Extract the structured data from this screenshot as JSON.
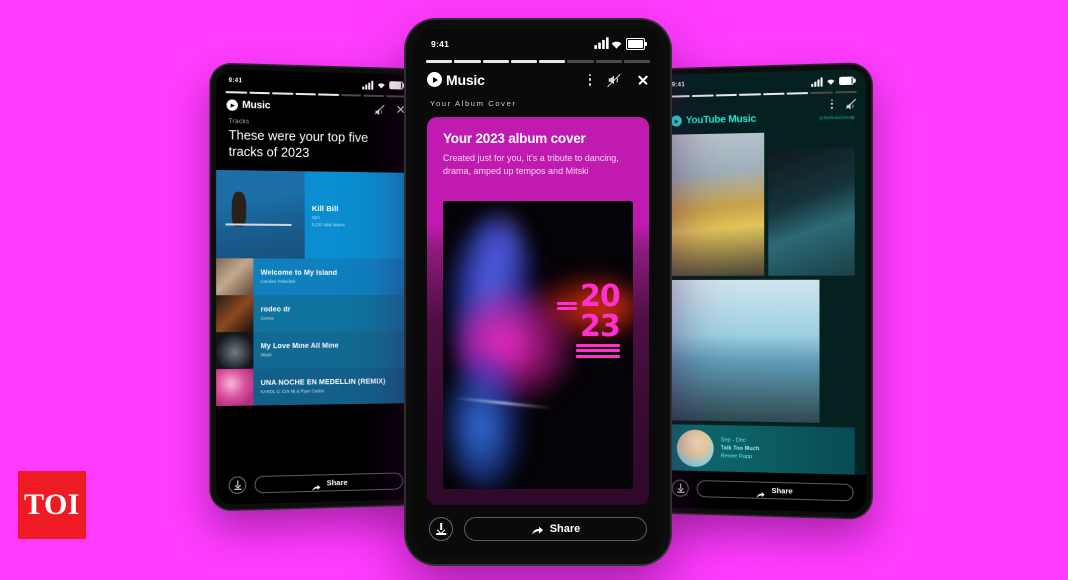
{
  "background_color": "#ff3bff",
  "watermark": {
    "text": "TOI",
    "bg": "#ee1b24"
  },
  "phone_left": {
    "status": {
      "time": "9:41"
    },
    "appbar": {
      "brand": "Music",
      "logo_icon": "youtube-music-logo-icon",
      "menu_icon": "kebab-menu-icon",
      "mute_icon": "mute-icon",
      "close_icon": "close-icon"
    },
    "eyebrow": "Tracks",
    "headline": "These were your top five tracks of 2023",
    "tracks": [
      {
        "title": "Kill Bill",
        "artist": "SZA",
        "plays": "5,233 total listens"
      },
      {
        "title": "Welcome to My Island",
        "artist": "Caroline Polachek"
      },
      {
        "title": "rodeo dr",
        "artist": "Gunna"
      },
      {
        "title": "My Love Mine All Mine",
        "artist": "Mitski"
      },
      {
        "title": "UNA NOCHE EN MEDELLÍN (REMIX)",
        "artist": "KAROL G, Cris Mj & Ryan Castro"
      }
    ],
    "actions": {
      "download_icon": "download-icon",
      "share_label": "Share",
      "share_icon": "share-arrow-icon"
    }
  },
  "phone_center": {
    "status": {
      "time": "9:41"
    },
    "appbar": {
      "brand": "Music",
      "logo_icon": "youtube-music-logo-icon",
      "menu_icon": "kebab-menu-icon",
      "mute_icon": "mute-icon",
      "close_icon": "close-icon"
    },
    "eyebrow": "Your Album Cover",
    "card": {
      "title": "Your 2023 album cover",
      "description": "Created just for you, it's a tribute to dancing, drama, amped up tempos and Mitski",
      "accent": "#c01ab0"
    },
    "artwork": {
      "year_top": "20",
      "year_bottom": "23",
      "accent": "#ff2fd0"
    },
    "actions": {
      "download_icon": "download-icon",
      "share_label": "Share",
      "share_icon": "share-arrow-icon"
    }
  },
  "phone_right": {
    "status": {
      "time": "9:41"
    },
    "appbar": {
      "brand": "YouTube Music",
      "logo_icon": "youtube-music-logo-icon",
      "menu_icon": "kebab-menu-icon",
      "mute_icon": "mute-icon",
      "close_icon": "close-icon",
      "url": "yt.be/musicrecap",
      "accent": "#25e8e0"
    },
    "now_card": {
      "period": "Sep - Dec",
      "title": "Talk Too Much",
      "artist": "Renee Rapp"
    },
    "actions": {
      "download_icon": "download-icon",
      "share_label": "Share",
      "share_icon": "share-arrow-icon"
    }
  }
}
